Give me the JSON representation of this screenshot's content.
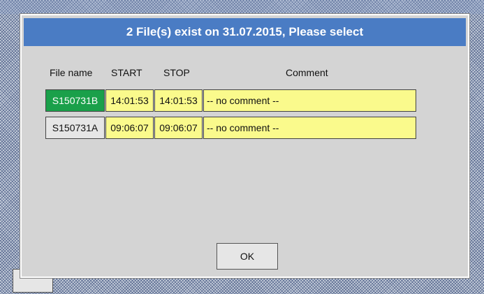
{
  "dialog": {
    "title": "2 File(s) exist on 31.07.2015, Please select",
    "ok_label": "OK"
  },
  "columns": {
    "file_name": "File name",
    "start": "START",
    "stop": "STOP",
    "comment": "Comment"
  },
  "files": [
    {
      "name": "S150731B",
      "start": "14:01:53",
      "stop": "14:01:53",
      "comment": "-- no comment --",
      "selected": true
    },
    {
      "name": "S150731A",
      "start": "09:06:07",
      "stop": "09:06:07",
      "comment": "-- no comment --",
      "selected": false
    }
  ],
  "colors": {
    "title_bar": "#4a7cc4",
    "selected_file": "#1aa04a",
    "field_yellow": "#fafa8c",
    "dialog_bg": "#d4d4d4"
  }
}
